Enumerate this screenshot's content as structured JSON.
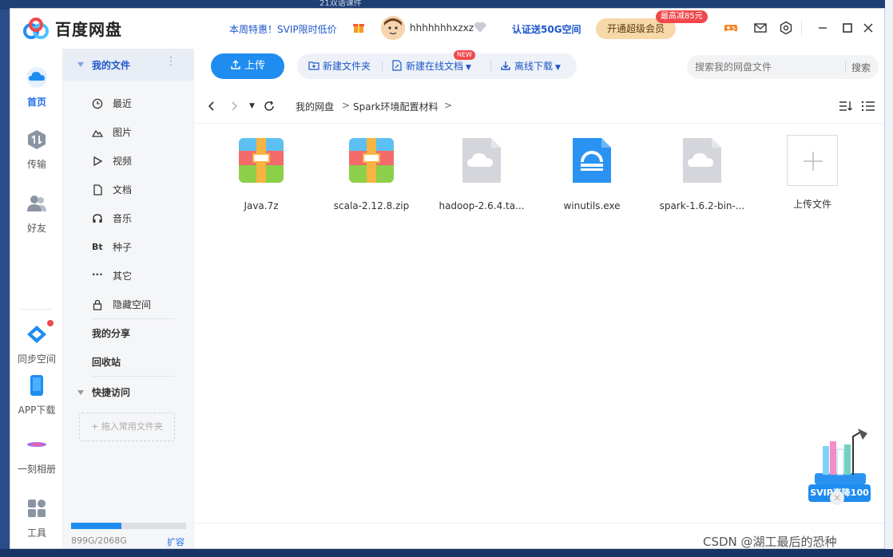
{
  "app": {
    "title": "百度网盘",
    "promo": "本周特惠！SVIP限时低价",
    "username": "hhhhhhhxzxz",
    "verify": "认证送50G空间",
    "vip_button": "开通超级会员",
    "vip_badge": "最高减85元"
  },
  "desktop": {
    "tab_text": "21双语课件"
  },
  "rail": {
    "items": [
      {
        "label": "首页",
        "icon": "cloud-home-icon"
      },
      {
        "label": "传输",
        "icon": "transfer-icon"
      },
      {
        "label": "好友",
        "icon": "friends-icon"
      },
      {
        "label": "同步空间",
        "icon": "sync-icon"
      },
      {
        "label": "APP下载",
        "icon": "phone-icon"
      },
      {
        "label": "一刻相册",
        "icon": "album-icon"
      },
      {
        "label": "工具",
        "icon": "tools-icon"
      }
    ]
  },
  "sidebar": {
    "my_files": "我的文件",
    "items": [
      {
        "label": "最近",
        "icon": "clock-icon"
      },
      {
        "label": "图片",
        "icon": "image-icon"
      },
      {
        "label": "视频",
        "icon": "play-icon"
      },
      {
        "label": "文档",
        "icon": "document-icon"
      },
      {
        "label": "音乐",
        "icon": "headphones-icon"
      },
      {
        "label": "种子",
        "icon": "bt-icon"
      },
      {
        "label": "其它",
        "icon": "more-icon"
      },
      {
        "label": "隐藏空间",
        "icon": "lock-icon"
      }
    ],
    "my_share": "我的分享",
    "recycle": "回收站",
    "quick_access": "快捷访问",
    "drop_hint": "+ 拖入常用文件夹",
    "quota_text": "899G/2068G",
    "quota_used_fraction": 0.435,
    "expand": "扩容"
  },
  "toolbar": {
    "upload": "上传",
    "new_folder": "新建文件夹",
    "new_online_doc": "新建在线文档",
    "new_badge": "NEW",
    "offline_download": "离线下载",
    "search_placeholder": "搜索我的网盘文件",
    "search_button": "搜索"
  },
  "breadcrumb": {
    "root": "我的网盘",
    "current": "Spark环境配置材料"
  },
  "files": [
    {
      "name": "Java.7z",
      "type": "archive"
    },
    {
      "name": "scala-2.12.8.zip",
      "type": "archive"
    },
    {
      "name": "hadoop-2.6.4.ta...",
      "type": "generic"
    },
    {
      "name": "winutils.exe",
      "type": "exe"
    },
    {
      "name": "spark-1.6.2-bin-...",
      "type": "generic"
    }
  ],
  "upload_tile": "上传文件",
  "svip_float": "SVIP直降100",
  "watermark": "CSDN @湖工最后的恐种",
  "colors": {
    "accent": "#1f8cf0",
    "link": "#1e56c9",
    "badge": "#f0484c",
    "vip_bg": "#f7d8a8"
  }
}
